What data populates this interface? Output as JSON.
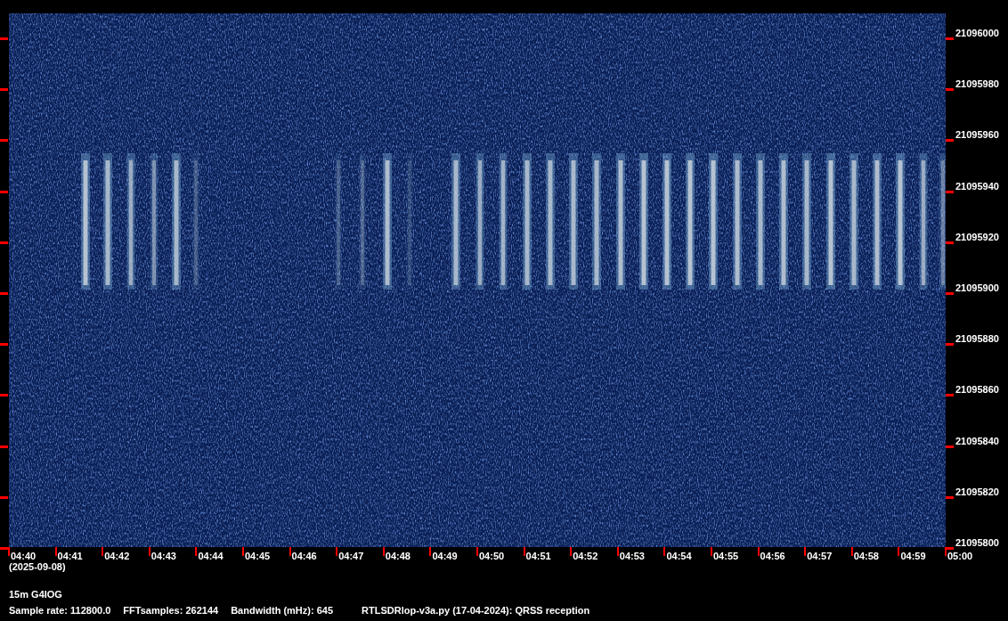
{
  "frequency_axis": {
    "labels": [
      "21096000",
      "21095980",
      "21095960",
      "21095940",
      "21095920",
      "21095900",
      "21095880",
      "21095860",
      "21095840",
      "21095820",
      "21095800"
    ]
  },
  "time_axis": {
    "labels": [
      "04:40",
      "04:41",
      "04:42",
      "04:43",
      "04:44",
      "04:45",
      "04:46",
      "04:47",
      "04:48",
      "04:49",
      "04:50",
      "04:51",
      "04:52",
      "04:53",
      "04:54",
      "04:55",
      "04:56",
      "04:57",
      "04:58",
      "04:59",
      "05:00"
    ],
    "date": "(2025-09-08)"
  },
  "footer": {
    "title": "15m G4IOG",
    "fields": [
      "Sample rate: 112800.0",
      "FFTsamples: 262144",
      "Bandwidth (mHz): 645",
      "RTLSDRlop-v3a.py (17-04-2024): QRSS reception"
    ]
  }
}
